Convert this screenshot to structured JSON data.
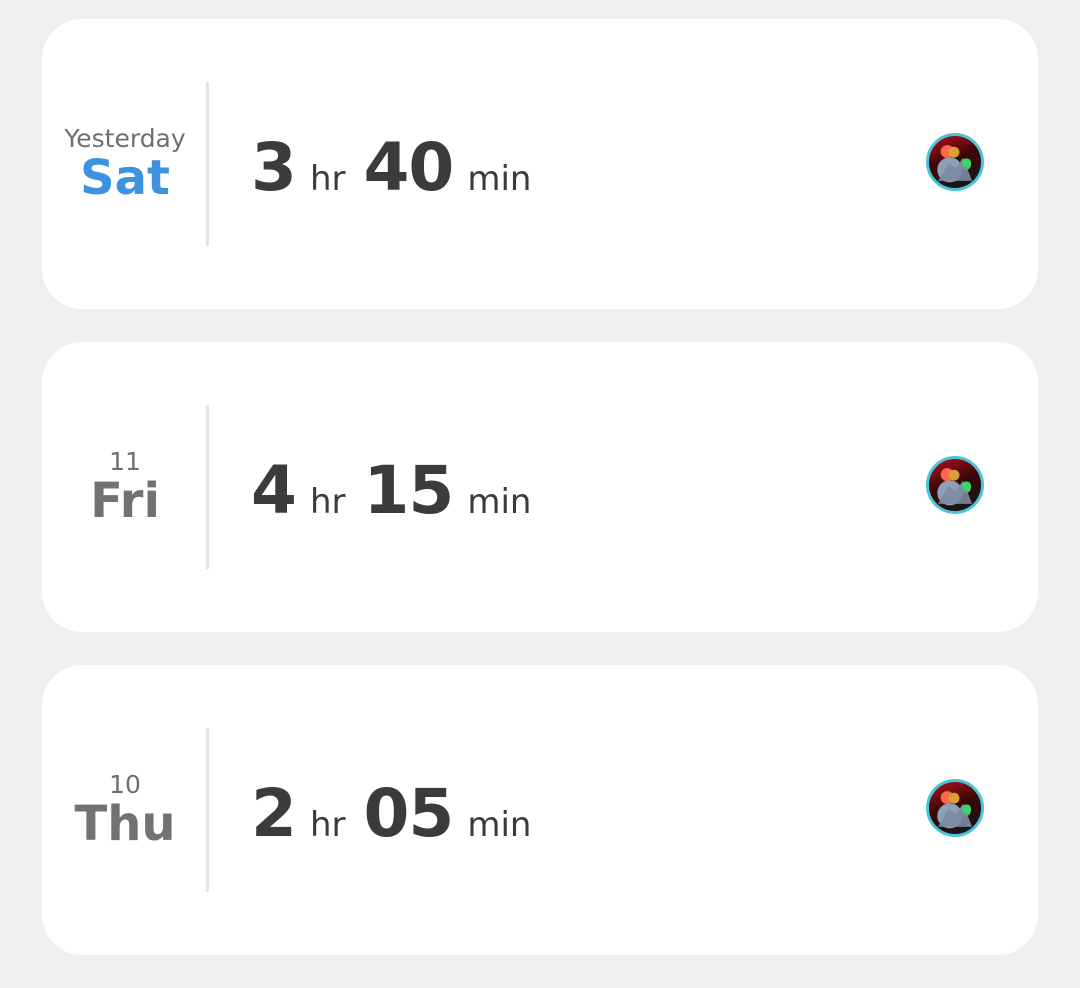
{
  "entries": [
    {
      "date_top": "Yesterday",
      "day": "Sat",
      "is_today_style": true,
      "hours": "3",
      "hours_unit": "hr",
      "minutes": "40",
      "minutes_unit": "min",
      "avatar_icon": "game-avatar-icon"
    },
    {
      "date_top": "11",
      "day": "Fri",
      "is_today_style": false,
      "hours": "4",
      "hours_unit": "hr",
      "minutes": "15",
      "minutes_unit": "min",
      "avatar_icon": "game-avatar-icon"
    },
    {
      "date_top": "10",
      "day": "Thu",
      "is_today_style": false,
      "hours": "2",
      "hours_unit": "hr",
      "minutes": "05",
      "minutes_unit": "min",
      "avatar_icon": "game-avatar-icon"
    }
  ],
  "colors": {
    "accent_day": "#3d93e0",
    "text_dark": "#3b3b3b",
    "text_muted": "#727272",
    "avatar_ring": "#4cc4d8",
    "background": "#efefef",
    "card": "#ffffff"
  }
}
